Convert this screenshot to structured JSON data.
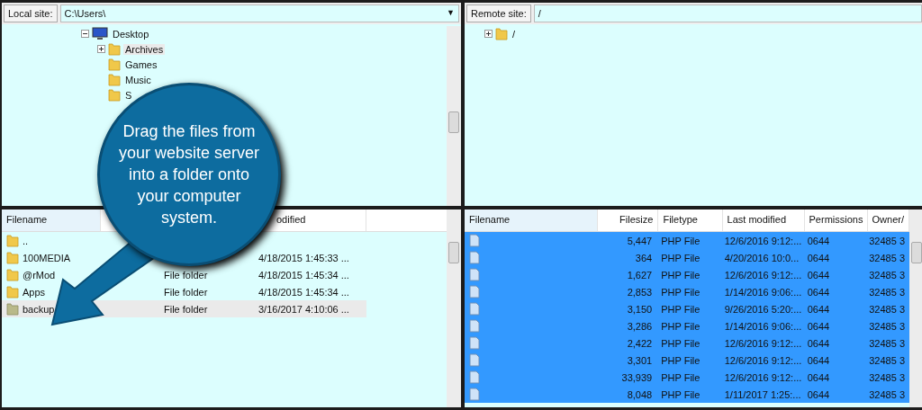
{
  "local": {
    "label": "Local site:",
    "path": "C:\\Users\\",
    "dropdown": "▼",
    "tree": [
      {
        "name": "Desktop",
        "kind": "desktop",
        "expanded": true,
        "children": [
          {
            "name": "Archives",
            "kind": "folder",
            "expanded": false,
            "has_children": true,
            "selected": true
          },
          {
            "name": "Games",
            "kind": "folder",
            "selected": false
          },
          {
            "name": "Music",
            "kind": "folder",
            "selected": false
          },
          {
            "name": "S",
            "kind": "folder",
            "selected": false
          }
        ]
      }
    ],
    "columns": [
      {
        "label": "Filename"
      },
      {
        "label": "odified"
      }
    ],
    "files": [
      {
        "name": "..",
        "selected": false
      },
      {
        "name": "100MEDIA",
        "modified": "4/18/2015 1:45:33 ...",
        "selected": false
      },
      {
        "name": "@rMod",
        "type": "File folder",
        "modified": "4/18/2015 1:45:34 ...",
        "selected": false
      },
      {
        "name": "Apps",
        "type": "File folder",
        "modified": "4/18/2015 1:45:34 ...",
        "selected": false
      },
      {
        "name": "backup",
        "type": "File folder",
        "modified": "3/16/2017 4:10:06 ...",
        "selected": true
      }
    ]
  },
  "remote": {
    "label": "Remote site:",
    "path": "/",
    "tree": [
      {
        "name": "/",
        "kind": "folder",
        "expanded": false,
        "has_children": true,
        "selected": false
      }
    ],
    "columns": [
      {
        "label": "Filename"
      },
      {
        "label": "Filesize"
      },
      {
        "label": "Filetype"
      },
      {
        "label": "Last modified"
      },
      {
        "label": "Permissions"
      },
      {
        "label": "Owner/"
      }
    ],
    "files": [
      {
        "size": "5,447",
        "type": "PHP File",
        "modified": "12/6/2016 9:12:...",
        "permissions": "0644",
        "owner": "32485 3",
        "selected": true
      },
      {
        "size": "364",
        "type": "PHP File",
        "modified": "4/20/2016 10:0...",
        "permissions": "0644",
        "owner": "32485 3",
        "selected": true
      },
      {
        "size": "1,627",
        "type": "PHP File",
        "modified": "12/6/2016 9:12:...",
        "permissions": "0644",
        "owner": "32485 3",
        "selected": true
      },
      {
        "size": "2,853",
        "type": "PHP File",
        "modified": "1/14/2016 9:06:...",
        "permissions": "0644",
        "owner": "32485 3",
        "selected": true
      },
      {
        "size": "3,150",
        "type": "PHP File",
        "modified": "9/26/2016 5:20:...",
        "permissions": "0644",
        "owner": "32485 3",
        "selected": true
      },
      {
        "size": "3,286",
        "type": "PHP File",
        "modified": "1/14/2016 9:06:...",
        "permissions": "0644",
        "owner": "32485 3",
        "selected": true
      },
      {
        "size": "2,422",
        "type": "PHP File",
        "modified": "12/6/2016 9:12:...",
        "permissions": "0644",
        "owner": "32485 3",
        "selected": true
      },
      {
        "size": "3,301",
        "type": "PHP File",
        "modified": "12/6/2016 9:12:...",
        "permissions": "0644",
        "owner": "32485 3",
        "selected": true
      },
      {
        "size": "33,939",
        "type": "PHP File",
        "modified": "12/6/2016 9:12:...",
        "permissions": "0644",
        "owner": "32485 3",
        "selected": true
      },
      {
        "size": "8,048",
        "type": "PHP File",
        "modified": "1/11/2017 1:25:...",
        "permissions": "0644",
        "owner": "32485 3",
        "selected": true
      }
    ]
  },
  "callout": {
    "text": "Drag the files from your website server into a folder onto your computer system."
  }
}
